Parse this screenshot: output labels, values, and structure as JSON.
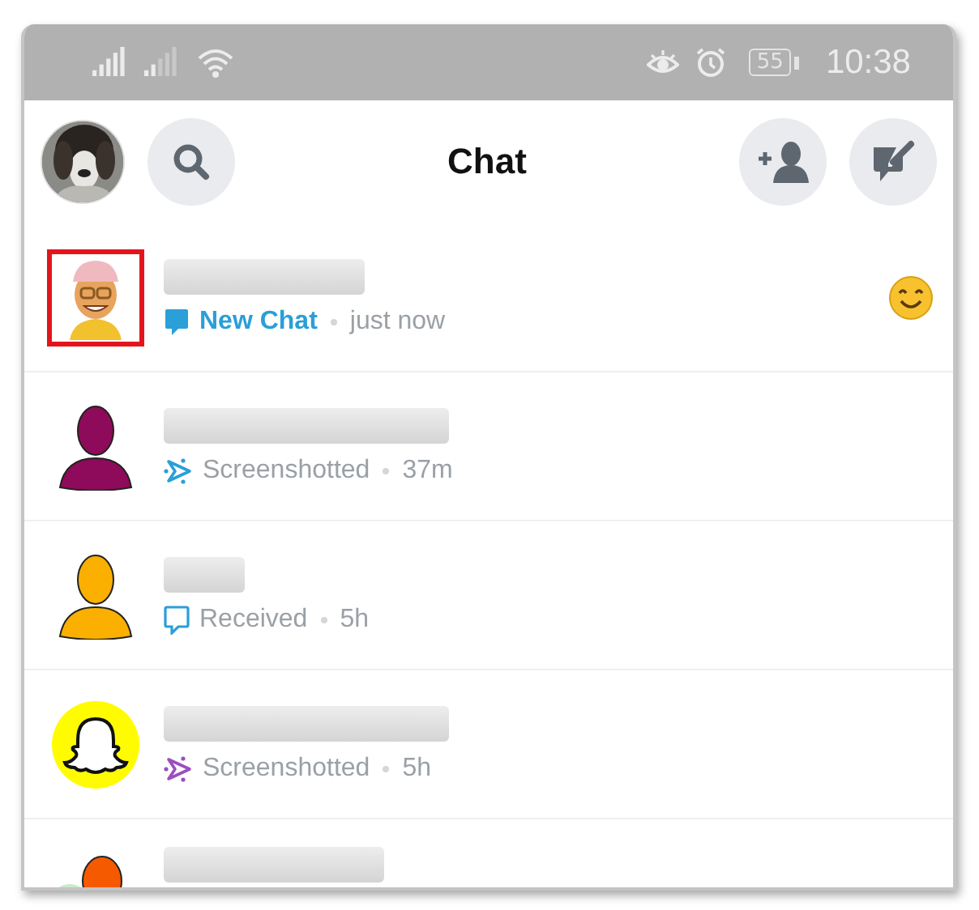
{
  "status_bar": {
    "battery": "55",
    "time": "10:38"
  },
  "header": {
    "title": "Chat"
  },
  "chats": [
    {
      "avatar": {
        "kind": "bitmoji",
        "highlighted": true
      },
      "status": {
        "kind": "new_chat",
        "label": "New Chat",
        "color": "#2a9fd8"
      },
      "time": "just now",
      "has_reaction": true
    },
    {
      "avatar": {
        "kind": "silhouette",
        "color": "#8e0a5a",
        "highlighted": false
      },
      "status": {
        "kind": "screenshotted",
        "label": "Screenshotted",
        "color": "#2a9fd8"
      },
      "time": "37m",
      "has_reaction": false
    },
    {
      "avatar": {
        "kind": "silhouette",
        "color": "#fbb000",
        "highlighted": false
      },
      "status": {
        "kind": "received",
        "label": "Received",
        "color": "#2a9fd8"
      },
      "time": "5h",
      "has_reaction": false
    },
    {
      "avatar": {
        "kind": "ghost",
        "highlighted": false
      },
      "status": {
        "kind": "screenshotted",
        "label": "Screenshotted",
        "color": "#9b4fc0"
      },
      "time": "5h",
      "has_reaction": false
    },
    {
      "avatar": {
        "kind": "group",
        "color": "#f55a00",
        "highlighted": false
      },
      "has_reaction": false
    }
  ]
}
